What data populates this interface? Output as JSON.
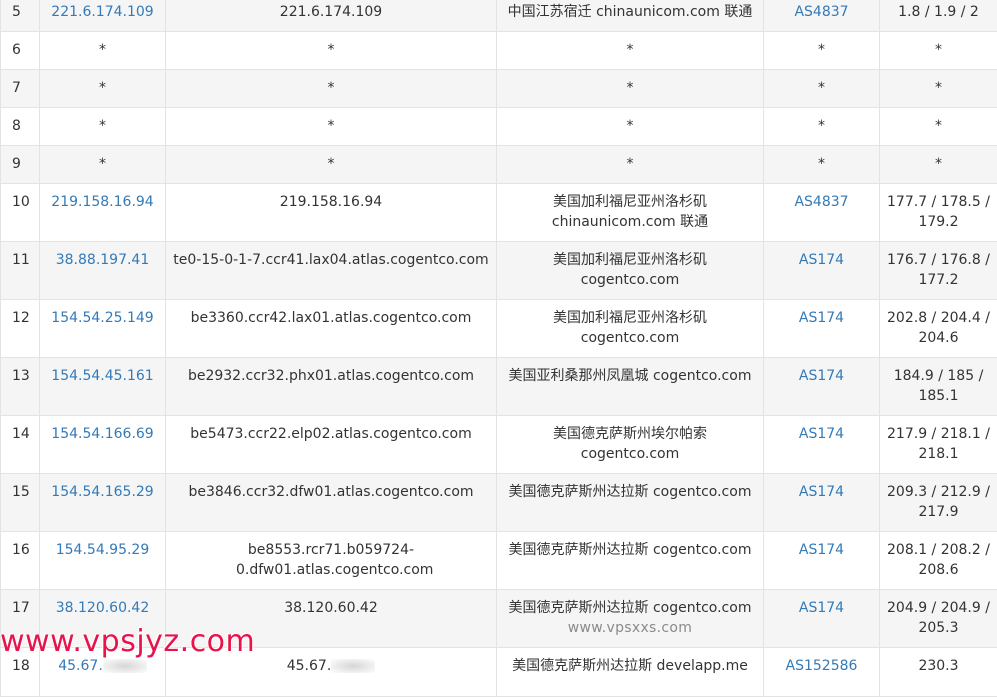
{
  "rows": [
    {
      "hop": "5",
      "ip": "221.6.174.109",
      "host": "221.6.174.109",
      "loc1": "中国江苏宿迁 chinaunicom.com 联通",
      "loc2": "",
      "asn": "AS4837",
      "lat1": "1.8 / 1.9 / 2",
      "lat2": ""
    },
    {
      "hop": "6",
      "ip": "*",
      "host": "*",
      "loc1": "*",
      "loc2": "",
      "asn": "*",
      "lat1": "*",
      "lat2": ""
    },
    {
      "hop": "7",
      "ip": "*",
      "host": "*",
      "loc1": "*",
      "loc2": "",
      "asn": "*",
      "lat1": "*",
      "lat2": ""
    },
    {
      "hop": "8",
      "ip": "*",
      "host": "*",
      "loc1": "*",
      "loc2": "",
      "asn": "*",
      "lat1": "*",
      "lat2": ""
    },
    {
      "hop": "9",
      "ip": "*",
      "host": "*",
      "loc1": "*",
      "loc2": "",
      "asn": "*",
      "lat1": "*",
      "lat2": ""
    },
    {
      "hop": "10",
      "ip": "219.158.16.94",
      "host": "219.158.16.94",
      "loc1": "美国加利福尼亚州洛杉矶",
      "loc2": "chinaunicom.com 联通",
      "asn": "AS4837",
      "lat1": "177.7 / 178.5 /",
      "lat2": "179.2"
    },
    {
      "hop": "11",
      "ip": "38.88.197.41",
      "host": "te0-15-0-1-7.ccr41.lax04.atlas.cogentco.com",
      "loc1": "美国加利福尼亚州洛杉矶",
      "loc2": "cogentco.com",
      "asn": "AS174",
      "lat1": "176.7 / 176.8 /",
      "lat2": "177.2"
    },
    {
      "hop": "12",
      "ip": "154.54.25.149",
      "host": "be3360.ccr42.lax01.atlas.cogentco.com",
      "loc1": "美国加利福尼亚州洛杉矶",
      "loc2": "cogentco.com",
      "asn": "AS174",
      "lat1": "202.8 / 204.4 /",
      "lat2": "204.6"
    },
    {
      "hop": "13",
      "ip": "154.54.45.161",
      "host": "be2932.ccr32.phx01.atlas.cogentco.com",
      "loc1": "美国亚利桑那州凤凰城 cogentco.com",
      "loc2": "",
      "asn": "AS174",
      "lat1": "184.9 / 185 /",
      "lat2": "185.1"
    },
    {
      "hop": "14",
      "ip": "154.54.166.69",
      "host": "be5473.ccr22.elp02.atlas.cogentco.com",
      "loc1": "美国德克萨斯州埃尔帕索",
      "loc2": "cogentco.com",
      "asn": "AS174",
      "lat1": "217.9 / 218.1 /",
      "lat2": "218.1"
    },
    {
      "hop": "15",
      "ip": "154.54.165.29",
      "host": "be3846.ccr32.dfw01.atlas.cogentco.com",
      "loc1": "美国德克萨斯州达拉斯 cogentco.com",
      "loc2": "",
      "asn": "AS174",
      "lat1": "209.3 / 212.9 /",
      "lat2": "217.9"
    },
    {
      "hop": "16",
      "ip": "154.54.95.29",
      "host": "be8553.rcr71.b059724-0.dfw01.atlas.cogentco.com",
      "loc1": "美国德克萨斯州达拉斯 cogentco.com",
      "loc2": "",
      "asn": "AS174",
      "lat1": "208.1 / 208.2 /",
      "lat2": "208.6"
    },
    {
      "hop": "17",
      "ip": "38.120.60.42",
      "host": "38.120.60.42",
      "loc1": "美国德克萨斯州达拉斯 cogentco.com",
      "loc2": "www.vpsxxs.com",
      "asn": "AS174",
      "lat1": "204.9 / 204.9 /",
      "lat2": "205.3"
    },
    {
      "hop": "18",
      "ip": "45.67.",
      "host": "45.67.",
      "loc1": "美国德克萨斯州达拉斯 develapp.me",
      "loc2": "",
      "asn": "AS152586",
      "lat1": "230.3",
      "lat2": ""
    }
  ],
  "watermark": "www.vpsjyz.com",
  "colors": {
    "link": "#337ab7",
    "border": "#e3e3e3",
    "stripe": "#f5f5f5",
    "watermark": "#e8134a"
  }
}
